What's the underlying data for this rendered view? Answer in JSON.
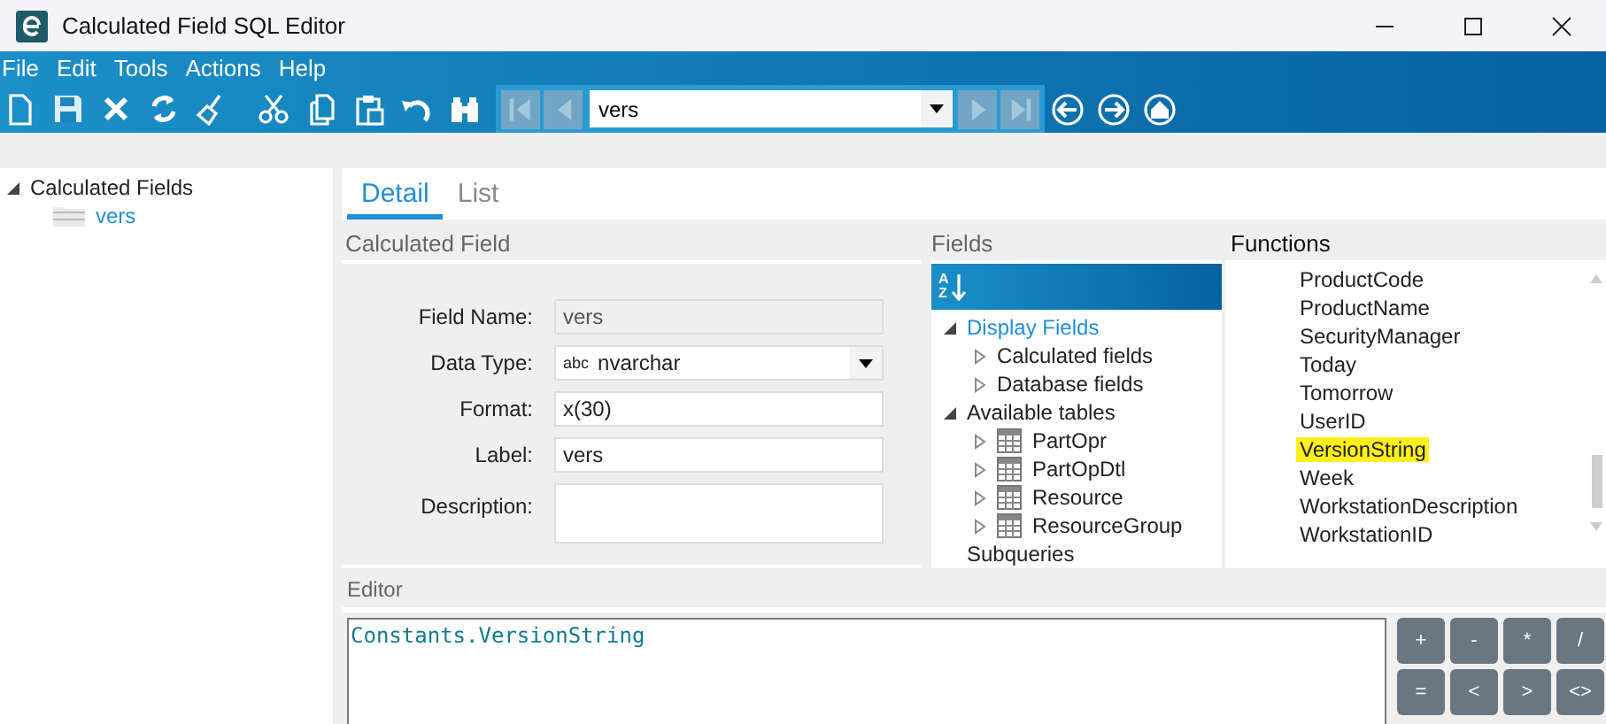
{
  "window": {
    "title": "Calculated Field SQL Editor"
  },
  "menu": [
    {
      "label": "File"
    },
    {
      "label": "Edit"
    },
    {
      "label": "Tools"
    },
    {
      "label": "Actions"
    },
    {
      "label": "Help"
    }
  ],
  "toolbar": {
    "buttons": [
      {
        "kind": "new"
      },
      {
        "kind": "save"
      },
      {
        "kind": "delete"
      },
      {
        "kind": "refresh"
      },
      {
        "kind": "clear"
      },
      {
        "kind": "cut"
      },
      {
        "kind": "copy"
      },
      {
        "kind": "paste"
      },
      {
        "kind": "undo"
      },
      {
        "kind": "find"
      }
    ],
    "nav_left": [
      {
        "kind": "first",
        "disabled": true
      },
      {
        "kind": "previous",
        "disabled": true
      }
    ],
    "record_combo": {
      "value": "vers"
    },
    "nav_right": [
      {
        "kind": "next",
        "disabled": true
      },
      {
        "kind": "last",
        "disabled": true
      }
    ],
    "links": [
      {
        "kind": "back"
      },
      {
        "kind": "forward"
      },
      {
        "kind": "home"
      }
    ]
  },
  "tree": [
    {
      "label": "Calculated Fields",
      "expanded": true,
      "selected": false,
      "children": [
        {
          "label": "vers",
          "selected": true
        }
      ]
    }
  ],
  "tabs": [
    {
      "label": "Detail",
      "selected": true
    },
    {
      "label": "List",
      "selected": false
    }
  ],
  "calculated_field": {
    "title": "Calculated Field",
    "fields": [
      {
        "label": "Field Name:",
        "kind": "text",
        "value": "vers",
        "disabled": true
      },
      {
        "label": "Data Type:",
        "kind": "select",
        "prefix": "abc",
        "value": "nvarchar",
        "disabled": false
      },
      {
        "label": "Format:",
        "kind": "text",
        "value": "x(30)",
        "disabled": false
      },
      {
        "label": "Label:",
        "kind": "text",
        "value": "vers",
        "disabled": false
      },
      {
        "label": "Description:",
        "kind": "textarea",
        "disabled": false
      }
    ]
  },
  "fields": {
    "title": "Fields",
    "sort_button": {
      "top": "A",
      "bottom": "Z"
    },
    "tree": [
      {
        "label": "Display Fields",
        "expanded": true,
        "selected": true,
        "children": [
          {
            "label": "Calculated fields",
            "expanded": false,
            "selected": false
          },
          {
            "label": "Database fields",
            "expanded": false,
            "selected": false
          }
        ]
      },
      {
        "label": "Available tables",
        "expanded": true,
        "selected": false,
        "children": [
          {
            "label": "PartOpr",
            "kind": "table",
            "expanded": false,
            "selected": false
          },
          {
            "label": "PartOpDtl",
            "kind": "table",
            "expanded": false,
            "selected": false
          },
          {
            "label": "Resource",
            "kind": "table",
            "expanded": false,
            "selected": false
          },
          {
            "label": "ResourceGroup",
            "kind": "table",
            "expanded": false,
            "selected": false
          }
        ]
      },
      {
        "label": "Subqueries",
        "selected": false
      }
    ]
  },
  "functions": {
    "title": "Functions",
    "items": [
      {
        "label": "ProductCode",
        "selected": false
      },
      {
        "label": "ProductName",
        "selected": false
      },
      {
        "label": "SecurityManager",
        "selected": false
      },
      {
        "label": "Today",
        "selected": false
      },
      {
        "label": "Tomorrow",
        "selected": false
      },
      {
        "label": "UserID",
        "selected": false
      },
      {
        "label": "VersionString",
        "selected": true
      },
      {
        "label": "Week",
        "selected": false
      },
      {
        "label": "WorkstationDescription",
        "selected": false
      },
      {
        "label": "WorkstationID",
        "selected": false
      }
    ]
  },
  "editor": {
    "title": "Editor",
    "text": "Constants.VersionString",
    "keypad": [
      "+",
      "-",
      "*",
      "/",
      "=",
      "<",
      ">",
      "<>"
    ]
  }
}
